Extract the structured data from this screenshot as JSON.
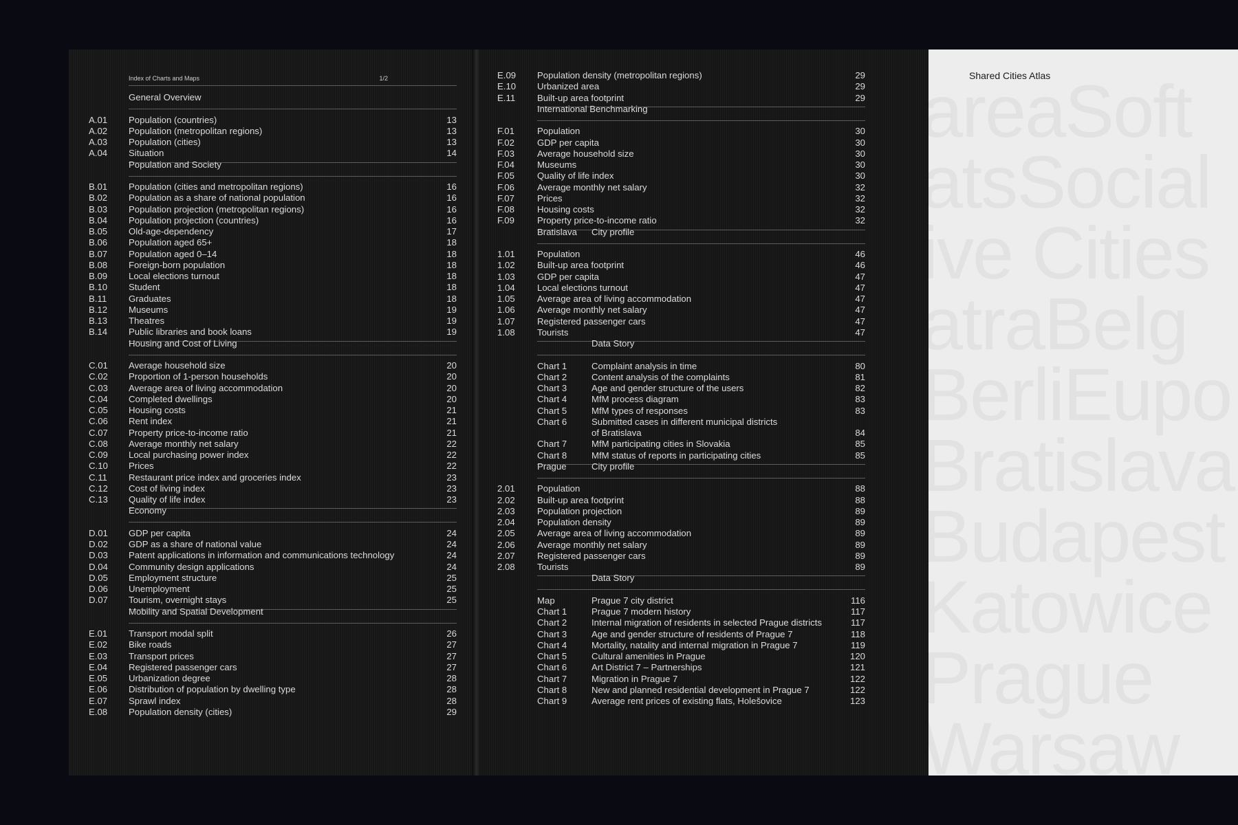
{
  "left_page": {
    "header": {
      "title": "Index of Charts and Maps",
      "page": "1/2"
    },
    "rows": [
      {
        "type": "section",
        "title": "General Overview"
      },
      {
        "code": "A.01",
        "label": "Population (countries)",
        "page": "13"
      },
      {
        "code": "A.02",
        "label": "Population (metropolitan regions)",
        "page": "13"
      },
      {
        "code": "A.03",
        "label": "Population (cities)",
        "page": "13"
      },
      {
        "code": "A.04",
        "label": "Situation",
        "page": "14"
      },
      {
        "type": "section",
        "title": "Population and Society"
      },
      {
        "code": "B.01",
        "label": "Population (cities and metropolitan regions)",
        "page": "16"
      },
      {
        "code": "B.02",
        "label": "Population as a share of national population",
        "page": "16"
      },
      {
        "code": "B.03",
        "label": "Population projection (metropolitan regions)",
        "page": "16"
      },
      {
        "code": "B.04",
        "label": "Population projection (countries)",
        "page": "16"
      },
      {
        "code": "B.05",
        "label": "Old-age-dependency",
        "page": "17"
      },
      {
        "code": "B.06",
        "label": "Population aged 65+",
        "page": "18"
      },
      {
        "code": "B.07",
        "label": "Population aged 0–14",
        "page": "18"
      },
      {
        "code": "B.08",
        "label": "Foreign-born population",
        "page": "18"
      },
      {
        "code": "B.09",
        "label": "Local elections turnout",
        "page": "18"
      },
      {
        "code": "B.10",
        "label": "Student",
        "page": "18"
      },
      {
        "code": "B.11",
        "label": "Graduates",
        "page": "18"
      },
      {
        "code": "B.12",
        "label": "Museums",
        "page": "19"
      },
      {
        "code": "B.13",
        "label": "Theatres",
        "page": "19"
      },
      {
        "code": "B.14",
        "label": "Public libraries and book loans",
        "page": "19"
      },
      {
        "type": "section",
        "title": "Housing and Cost of Living"
      },
      {
        "code": "C.01",
        "label": "Average household size",
        "page": "20"
      },
      {
        "code": "C.02",
        "label": "Proportion of 1-person households",
        "page": "20"
      },
      {
        "code": "C.03",
        "label": "Average area of living accommodation",
        "page": "20"
      },
      {
        "code": "C.04",
        "label": "Completed dwellings",
        "page": "20"
      },
      {
        "code": "C.05",
        "label": "Housing costs",
        "page": "21"
      },
      {
        "code": "C.06",
        "label": "Rent index",
        "page": "21"
      },
      {
        "code": "C.07",
        "label": "Property price-to-income ratio",
        "page": "21"
      },
      {
        "code": "C.08",
        "label": "Average monthly net salary",
        "page": "22"
      },
      {
        "code": "C.09",
        "label": "Local purchasing power index",
        "page": "22"
      },
      {
        "code": "C.10",
        "label": "Prices",
        "page": "22"
      },
      {
        "code": "C.11",
        "label": "Restaurant price index and groceries index",
        "page": "23"
      },
      {
        "code": "C.12",
        "label": "Cost of living index",
        "page": "23"
      },
      {
        "code": "C.13",
        "label": "Quality of life index",
        "page": "23"
      },
      {
        "type": "section",
        "title": "Economy"
      },
      {
        "code": "D.01",
        "label": "GDP per capita",
        "page": "24"
      },
      {
        "code": "D.02",
        "label": "GDP as a share of national value",
        "page": "24"
      },
      {
        "code": "D.03",
        "label": "Patent applications in information and communications technology",
        "page": "24"
      },
      {
        "code": "D.04",
        "label": "Community design applications",
        "page": "24"
      },
      {
        "code": "D.05",
        "label": "Employment structure",
        "page": "25"
      },
      {
        "code": "D.06",
        "label": "Unemployment",
        "page": "25"
      },
      {
        "code": "D.07",
        "label": "Tourism, overnight stays",
        "page": "25"
      },
      {
        "type": "section",
        "title": "Mobility and Spatial Development"
      },
      {
        "code": "E.01",
        "label": "Transport modal split",
        "page": "26"
      },
      {
        "code": "E.02",
        "label": "Bike roads",
        "page": "27"
      },
      {
        "code": "E.03",
        "label": "Transport prices",
        "page": "27"
      },
      {
        "code": "E.04",
        "label": "Registered passenger cars",
        "page": "27"
      },
      {
        "code": "E.05",
        "label": "Urbanization degree",
        "page": "28"
      },
      {
        "code": "E.06",
        "label": "Distribution of population by dwelling type",
        "page": "28"
      },
      {
        "code": "E.07",
        "label": "Sprawl index",
        "page": "28"
      },
      {
        "code": "E.08",
        "label": "Population density (cities)",
        "page": "29"
      }
    ]
  },
  "middle_page": {
    "rows": [
      {
        "code": "E.09",
        "label": "Population density (metropolitan regions)",
        "page": "29"
      },
      {
        "code": "E.10",
        "label": "Urbanized area",
        "page": "29"
      },
      {
        "code": "E.11",
        "label": "Built-up area footprint",
        "page": "29"
      },
      {
        "type": "section",
        "title": "International Benchmarking"
      },
      {
        "code": "F.01",
        "label": "Population",
        "page": "30"
      },
      {
        "code": "F.02",
        "label": "GDP per capita",
        "page": "30"
      },
      {
        "code": "F.03",
        "label": "Average household size",
        "page": "30"
      },
      {
        "code": "F.04",
        "label": "Museums",
        "page": "30"
      },
      {
        "code": "F.05",
        "label": "Quality of life index",
        "page": "30"
      },
      {
        "code": "F.06",
        "label": "Average monthly net salary",
        "page": "32"
      },
      {
        "code": "F.07",
        "label": "Prices",
        "page": "32"
      },
      {
        "code": "F.08",
        "label": "Housing costs",
        "page": "32"
      },
      {
        "code": "F.09",
        "label": "Property price-to-income ratio",
        "page": "32"
      },
      {
        "type": "section",
        "title": "Bratislava",
        "title2": "City profile"
      },
      {
        "code": "1.01",
        "label": "Population",
        "page": "46"
      },
      {
        "code": "1.02",
        "label": "Built-up area footprint",
        "page": "46"
      },
      {
        "code": "1.03",
        "label": "GDP per capita",
        "page": "47"
      },
      {
        "code": "1.04",
        "label": "Local elections turnout",
        "page": "47"
      },
      {
        "code": "1.05",
        "label": "Average area of living accommodation",
        "page": "47"
      },
      {
        "code": "1.06",
        "label": "Average monthly net salary",
        "page": "47"
      },
      {
        "code": "1.07",
        "label": "Registered passenger cars",
        "page": "47"
      },
      {
        "code": "1.08",
        "label": "Tourists",
        "page": "47"
      },
      {
        "type": "section",
        "title": "",
        "title2": "Data Story"
      },
      {
        "type": "chart",
        "chart": "Chart 1",
        "label": "Complaint analysis in time",
        "page": "80"
      },
      {
        "type": "chart",
        "chart": "Chart 2",
        "label": "Content analysis of the complaints",
        "page": "81"
      },
      {
        "type": "chart",
        "chart": "Chart 3",
        "label": "Age and gender structure of the users",
        "page": "82"
      },
      {
        "type": "chart",
        "chart": "Chart 4",
        "label": "MfM process diagram",
        "page": "83"
      },
      {
        "type": "chart",
        "chart": "Chart 5",
        "label": "MfM types of responses",
        "page": "83"
      },
      {
        "type": "chart",
        "chart": "Chart 6",
        "label": "Submitted cases in different municipal districts",
        "page": ""
      },
      {
        "type": "chart",
        "chart": "",
        "label": "of Bratislava",
        "page": "84"
      },
      {
        "type": "chart",
        "chart": "Chart 7",
        "label": "MfM participating cities in Slovakia",
        "page": "85"
      },
      {
        "type": "chart",
        "chart": "Chart 8",
        "label": "MfM status of reports in participating cities",
        "page": "85"
      },
      {
        "type": "section",
        "title": "Prague",
        "title2": "City profile"
      },
      {
        "code": "2.01",
        "label": "Population",
        "page": "88"
      },
      {
        "code": "2.02",
        "label": "Built-up area footprint",
        "page": "88"
      },
      {
        "code": "2.03",
        "label": "Population projection",
        "page": "89"
      },
      {
        "code": "2.04",
        "label": "Population density",
        "page": "89"
      },
      {
        "code": "2.05",
        "label": "Average area of living accommodation",
        "page": "89"
      },
      {
        "code": "2.06",
        "label": "Average monthly net salary",
        "page": "89"
      },
      {
        "code": "2.07",
        "label": "Registered passenger cars",
        "page": "89"
      },
      {
        "code": "2.08",
        "label": "Tourists",
        "page": "89"
      },
      {
        "type": "section",
        "title": "",
        "title2": "Data Story"
      },
      {
        "type": "chart",
        "chart": "Map",
        "label": "Prague 7 city district",
        "page": "116"
      },
      {
        "type": "chart",
        "chart": "Chart 1",
        "label": "Prague 7 modern history",
        "page": "117"
      },
      {
        "type": "chart",
        "chart": "Chart 2",
        "label": "Internal migration of residents in selected Prague districts",
        "page": "117"
      },
      {
        "type": "chart",
        "chart": "Chart 3",
        "label": "Age and gender structure of residents of Prague 7",
        "page": "118"
      },
      {
        "type": "chart",
        "chart": "Chart 4",
        "label": "Mortality, natality and internal migration in Prague 7",
        "page": "119"
      },
      {
        "type": "chart",
        "chart": "Chart 5",
        "label": "Cultural amenities in Prague",
        "page": "120"
      },
      {
        "type": "chart",
        "chart": "Chart 6",
        "label": "Art District 7 – Partnerships",
        "page": "121"
      },
      {
        "type": "chart",
        "chart": "Chart 7",
        "label": "Migration in Prague 7",
        "page": "122"
      },
      {
        "type": "chart",
        "chart": "Chart 8",
        "label": "New and planned residential development in Prague 7",
        "page": "122"
      },
      {
        "type": "chart",
        "chart": "Chart 9",
        "label": "Average rent prices of existing flats, Holešovice",
        "page": "123"
      }
    ]
  },
  "right_page": {
    "title": "Shared Cities Atlas",
    "ghost_words": [
      "areaSoft",
      "atsSocial",
      "ive Cities",
      "atraBelg",
      "BerliEupo",
      "Bratislava",
      "Budapest",
      "Katowice",
      "Prague",
      "Warsaw"
    ],
    "colors": {
      "paper": "#ededed",
      "ghost": "#e2e2e2",
      "title": "#1a1a1a"
    }
  }
}
